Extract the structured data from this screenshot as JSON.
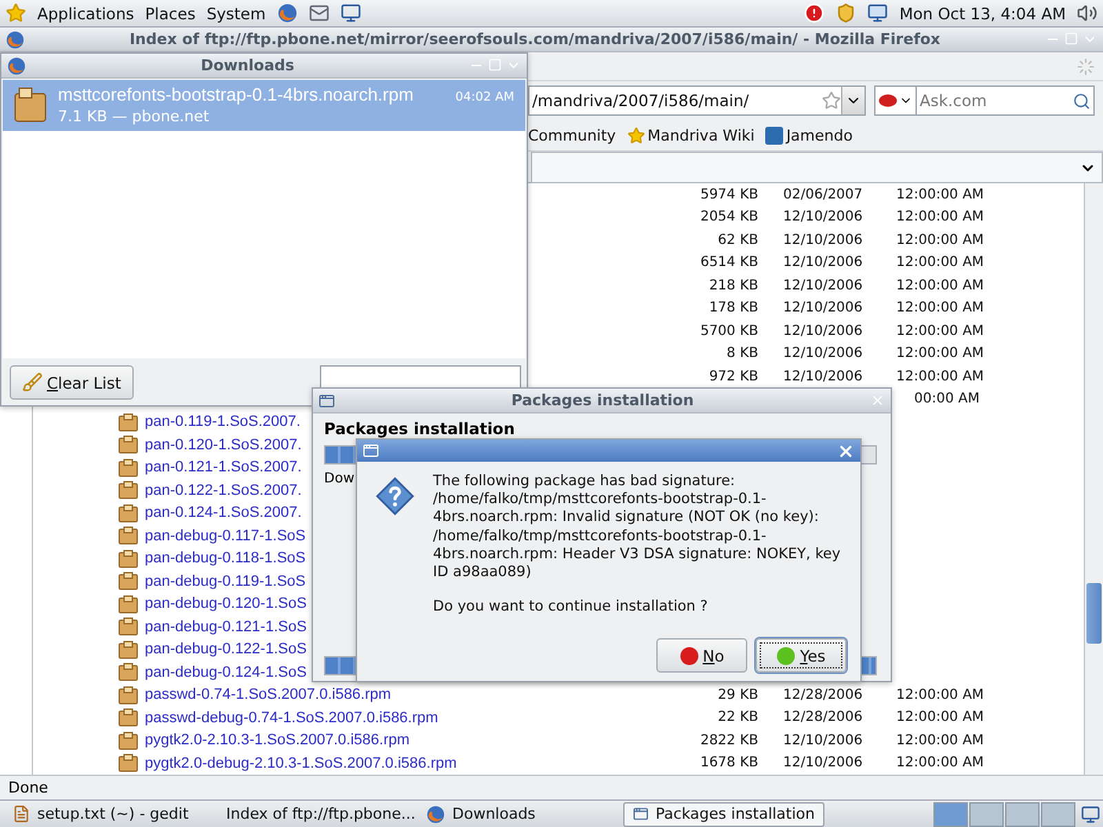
{
  "top_panel": {
    "menus": [
      "Applications",
      "Places",
      "System"
    ],
    "clock": "Mon Oct 13,  4:04 AM"
  },
  "firefox": {
    "title": "Index of ftp://ftp.pbone.net/mirror/seerofsouls.com/mandriva/2007/i586/main/ - Mozilla Firefox",
    "url": "/mandriva/2007/i586/main/",
    "search_placeholder": "Ask.com",
    "bookmarks": [
      "Community",
      "Mandriva Wiki",
      "Jamendo"
    ],
    "rows": [
      {
        "size": "5974 KB",
        "date": "02/06/2007",
        "time": "12:00:00 AM"
      },
      {
        "size": "2054 KB",
        "date": "12/10/2006",
        "time": "12:00:00 AM"
      },
      {
        "size": "62 KB",
        "date": "12/10/2006",
        "time": "12:00:00 AM"
      },
      {
        "size": "6514 KB",
        "date": "12/10/2006",
        "time": "12:00:00 AM"
      },
      {
        "size": "218 KB",
        "date": "12/10/2006",
        "time": "12:00:00 AM"
      },
      {
        "size": "178 KB",
        "date": "12/10/2006",
        "time": "12:00:00 AM"
      },
      {
        "size": "5700 KB",
        "date": "12/10/2006",
        "time": "12:00:00 AM"
      },
      {
        "size": "8 KB",
        "date": "12/10/2006",
        "time": "12:00:00 AM"
      },
      {
        "size": "972 KB",
        "date": "12/10/2006",
        "time": "12:00:00 AM"
      },
      {
        "time": "00:00 AM"
      },
      {
        "name": "pan-0.119-1.SoS.2007."
      },
      {
        "name": "pan-0.120-1.SoS.2007."
      },
      {
        "name": "pan-0.121-1.SoS.2007."
      },
      {
        "name": "pan-0.122-1.SoS.2007."
      },
      {
        "name": "pan-0.124-1.SoS.2007."
      },
      {
        "name": "pan-debug-0.117-1.SoS"
      },
      {
        "name": "pan-debug-0.118-1.SoS"
      },
      {
        "name": "pan-debug-0.119-1.SoS"
      },
      {
        "name": "pan-debug-0.120-1.SoS"
      },
      {
        "name": "pan-debug-0.121-1.SoS"
      },
      {
        "name": "pan-debug-0.122-1.SoS"
      },
      {
        "name": "pan-debug-0.124-1.SoS"
      },
      {
        "name": "passwd-0.74-1.SoS.2007.0.i586.rpm",
        "size": "29 KB",
        "date": "12/28/2006",
        "time": "12:00:00 AM"
      },
      {
        "name": "passwd-debug-0.74-1.SoS.2007.0.i586.rpm",
        "size": "22 KB",
        "date": "12/28/2006",
        "time": "12:00:00 AM"
      },
      {
        "name": "pygtk2.0-2.10.3-1.SoS.2007.0.i586.rpm",
        "size": "2822 KB",
        "date": "12/10/2006",
        "time": "12:00:00 AM"
      },
      {
        "name": "pygtk2.0-debug-2.10.3-1.SoS.2007.0.i586.rpm",
        "size": "1678 KB",
        "date": "12/10/2006",
        "time": "12:00:00 AM"
      }
    ],
    "status": "Done"
  },
  "downloads": {
    "title": "Downloads",
    "items": [
      {
        "name": "msttcorefonts-bootstrap-0.1-4brs.noarch.rpm",
        "time": "04:02 AM",
        "details": "7.1 KB — pbone.net",
        "selected": true
      }
    ],
    "clear_button": "Clear List"
  },
  "packages_window": {
    "title": "Packages installation",
    "heading": "Packages installation",
    "status": "Dow",
    "progress": [
      {
        "level": 0.5
      },
      {
        "level": 1
      }
    ]
  },
  "dialog": {
    "message": "The following package has bad signature: /home/falko/tmp/msttcorefonts-bootstrap-0.1-4brs.noarch.rpm: Invalid signature (NOT OK (no key): /home/falko/tmp/msttcorefonts-bootstrap-0.1-4brs.noarch.rpm: Header V3 DSA signature: NOKEY, key ID a98aa089)",
    "question": "Do you want to continue installation ?",
    "buttons": [
      {
        "label": "No",
        "kind": "no",
        "focused": false
      },
      {
        "label": "Yes",
        "kind": "yes",
        "focused": true
      }
    ]
  },
  "taskbar": {
    "items": [
      {
        "label": "setup.txt (~) - gedit",
        "kind": "editor",
        "selected": false
      },
      {
        "label": "Index of ftp://ftp.pbone...",
        "kind": "browser",
        "selected": false
      },
      {
        "label": "Downloads",
        "kind": "browser",
        "selected": false
      },
      {
        "label": "Packages installation",
        "kind": "window",
        "selected": true
      }
    ],
    "workspaces": [
      {
        "selected": true
      },
      {
        "selected": false
      },
      {
        "selected": false
      },
      {
        "selected": false
      }
    ]
  }
}
